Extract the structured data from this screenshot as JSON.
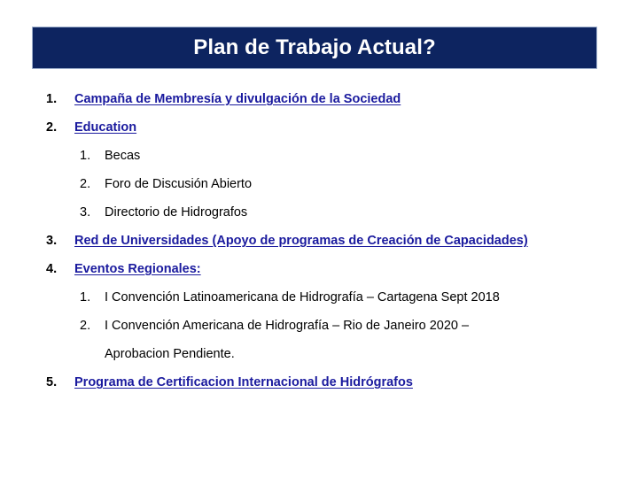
{
  "slide": {
    "title": "Plan de Trabajo Actual?",
    "title_bar_color": "#0d2460",
    "title_text_color": "#ffffff",
    "link_color": "#1a1a9e",
    "background_color": "#ffffff"
  },
  "items": [
    {
      "number": "1.",
      "text": "Campaña de Membresía y divulgación de la Sociedad"
    },
    {
      "number": "2.",
      "text": "Education"
    },
    {
      "number": "1.",
      "text": "Becas"
    },
    {
      "number": "2.",
      "text": "Foro de Discusión Abierto"
    },
    {
      "number": "3.",
      "text": "Directorio de Hidrografos"
    },
    {
      "number": "3.",
      "text": "Red de Universidades (Apoyo de programas de Creación de Capacidades)"
    },
    {
      "number": "4.",
      "text": "Eventos Regionales:"
    },
    {
      "number": "1.",
      "text": "I Convención Latinoamericana de Hidrografía – Cartagena Sept 2018"
    },
    {
      "number": "2.",
      "text": "I Convención Americana de Hidrografía – Rio de Janeiro 2020 –"
    },
    {
      "number": "",
      "text": "Aprobacion Pendiente."
    },
    {
      "number": "5.",
      "text": "Programa de Certificacion Internacional de Hidrógrafos"
    }
  ]
}
